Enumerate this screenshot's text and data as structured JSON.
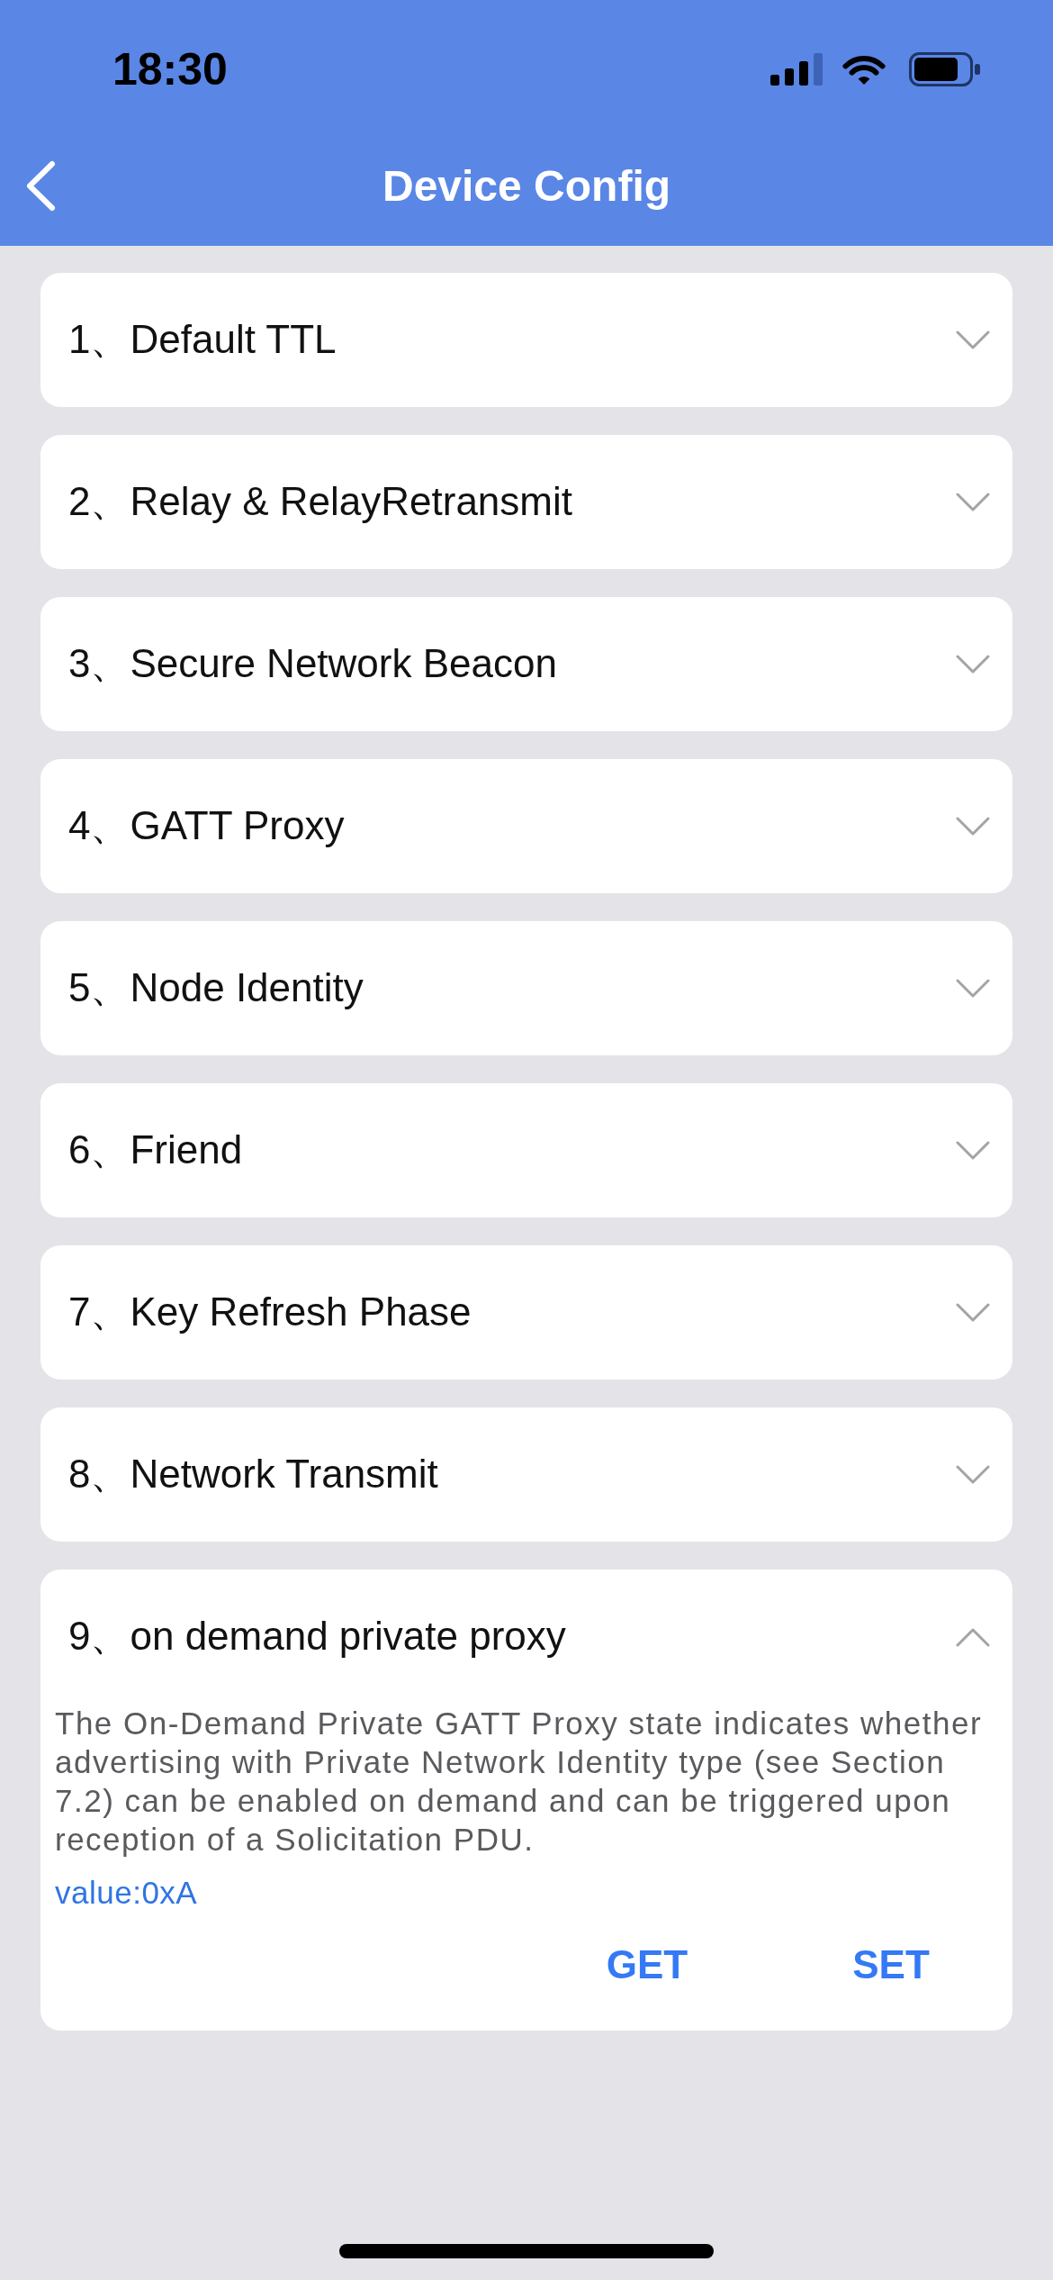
{
  "status_bar": {
    "time": "18:30"
  },
  "nav_bar": {
    "title": "Device Config"
  },
  "sections": [
    {
      "title": "1、Default TTL",
      "expanded": false
    },
    {
      "title": "2、Relay & RelayRetransmit",
      "expanded": false
    },
    {
      "title": "3、Secure Network Beacon",
      "expanded": false
    },
    {
      "title": "4、GATT Proxy",
      "expanded": false
    },
    {
      "title": "5、Node Identity",
      "expanded": false
    },
    {
      "title": "6、Friend",
      "expanded": false
    },
    {
      "title": "7、Key Refresh Phase",
      "expanded": false
    },
    {
      "title": "8、Network Transmit",
      "expanded": false
    },
    {
      "title": "9、on demand private proxy",
      "expanded": true,
      "description": "The On-Demand Private GATT Proxy state indicates whether advertising with Private Network Identity type (see Section 7.2) can be enabled on demand and can be triggered upon reception of a Solicitation PDU.",
      "value": "value:0xA",
      "buttons": [
        "GET",
        "SET"
      ]
    }
  ]
}
